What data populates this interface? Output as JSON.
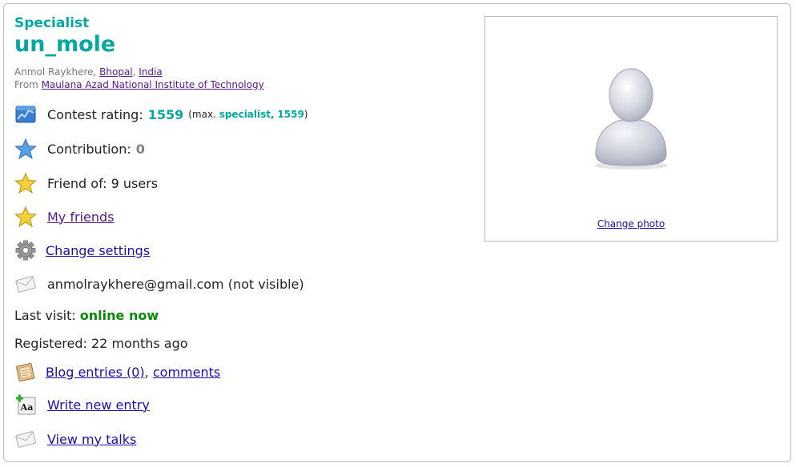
{
  "profile": {
    "rank": "Specialist",
    "handle": "un_mole",
    "name": "Anmol Raykhere",
    "city": "Bhopal",
    "country": "India",
    "from_prefix": "From",
    "organization": "Maulana Azad National Institute of Technology"
  },
  "rating": {
    "label": "Contest rating:",
    "value": "1559",
    "max_prefix": "(max.",
    "max_rank": "specialist,",
    "max_value": "1559",
    "max_suffix": ")"
  },
  "contribution": {
    "label": "Contribution:",
    "value": "0"
  },
  "friends": {
    "friend_of": "Friend of: 9 users",
    "my_friends": "My friends"
  },
  "settings": {
    "change_settings": "Change settings"
  },
  "email": {
    "text": "anmolraykhere@gmail.com (not visible)"
  },
  "visit": {
    "label": "Last visit:",
    "value": "online now"
  },
  "registered": {
    "text": "Registered: 22 months ago"
  },
  "blog": {
    "entries": "Blog entries (0)",
    "separator": ",",
    "comments": "comments",
    "write_new": "Write new entry",
    "view_talks": "View my talks"
  },
  "photo": {
    "change_photo": "Change photo"
  },
  "colors": {
    "specialist": "#03a89e",
    "link": "#1a0dab",
    "visited_link": "#551a8b",
    "online": "#0a8a0a"
  }
}
